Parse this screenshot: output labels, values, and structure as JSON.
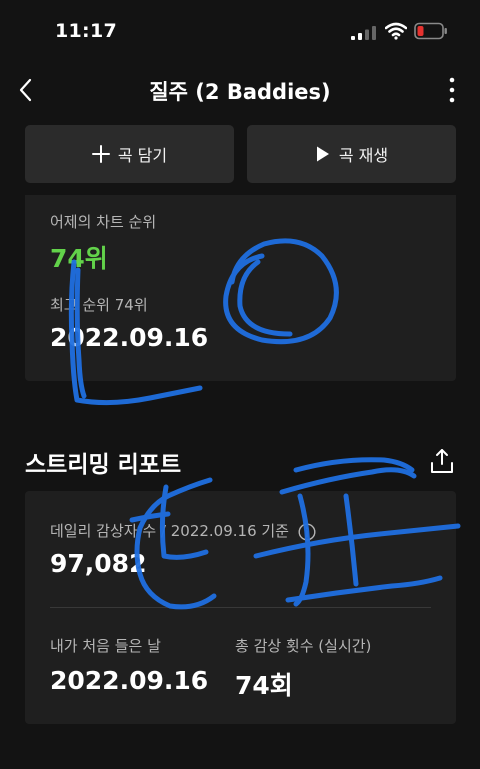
{
  "status_bar": {
    "time": "11:17"
  },
  "nav": {
    "title": "질주 (2 Baddies)"
  },
  "actions": {
    "add_label": "곡 담기",
    "play_label": "곡 재생"
  },
  "chart_card": {
    "yesterday_label": "어제의 차트 순위",
    "yesterday_rank": "74위",
    "best_label": "최고 순위 74위",
    "best_date": "2022.09.16"
  },
  "report": {
    "title": "스트리밍 리포트",
    "daily_label": "데일리 감상자 수 / 2022.09.16 기준",
    "daily_value": "97,082",
    "first_listen_label": "내가 처음 들은 날",
    "first_listen_value": "2022.09.16",
    "total_label": "총 감상 횟수 (실시간)",
    "total_value": "74회"
  },
  "colors": {
    "accent_green": "#62d24a",
    "background": "#131313",
    "card": "#1f1f1f",
    "button": "#2b2b2b",
    "scribble_blue": "#1f6fe0",
    "battery_red": "#e5322f"
  },
  "icons": [
    "signal-icon",
    "wifi-icon",
    "battery-icon",
    "back-chevron-icon",
    "more-vertical-icon",
    "plus-icon",
    "play-icon",
    "share-icon",
    "info-icon"
  ]
}
